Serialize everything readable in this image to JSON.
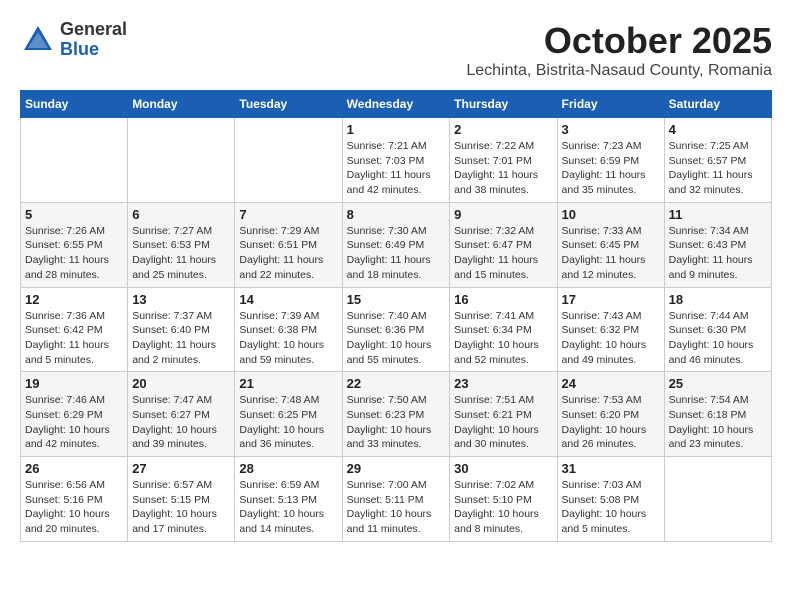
{
  "header": {
    "logo_general": "General",
    "logo_blue": "Blue",
    "month": "October 2025",
    "location": "Lechinta, Bistrita-Nasaud County, Romania"
  },
  "weekdays": [
    "Sunday",
    "Monday",
    "Tuesday",
    "Wednesday",
    "Thursday",
    "Friday",
    "Saturday"
  ],
  "weeks": [
    [
      {
        "day": "",
        "info": ""
      },
      {
        "day": "",
        "info": ""
      },
      {
        "day": "",
        "info": ""
      },
      {
        "day": "1",
        "info": "Sunrise: 7:21 AM\nSunset: 7:03 PM\nDaylight: 11 hours\nand 42 minutes."
      },
      {
        "day": "2",
        "info": "Sunrise: 7:22 AM\nSunset: 7:01 PM\nDaylight: 11 hours\nand 38 minutes."
      },
      {
        "day": "3",
        "info": "Sunrise: 7:23 AM\nSunset: 6:59 PM\nDaylight: 11 hours\nand 35 minutes."
      },
      {
        "day": "4",
        "info": "Sunrise: 7:25 AM\nSunset: 6:57 PM\nDaylight: 11 hours\nand 32 minutes."
      }
    ],
    [
      {
        "day": "5",
        "info": "Sunrise: 7:26 AM\nSunset: 6:55 PM\nDaylight: 11 hours\nand 28 minutes."
      },
      {
        "day": "6",
        "info": "Sunrise: 7:27 AM\nSunset: 6:53 PM\nDaylight: 11 hours\nand 25 minutes."
      },
      {
        "day": "7",
        "info": "Sunrise: 7:29 AM\nSunset: 6:51 PM\nDaylight: 11 hours\nand 22 minutes."
      },
      {
        "day": "8",
        "info": "Sunrise: 7:30 AM\nSunset: 6:49 PM\nDaylight: 11 hours\nand 18 minutes."
      },
      {
        "day": "9",
        "info": "Sunrise: 7:32 AM\nSunset: 6:47 PM\nDaylight: 11 hours\nand 15 minutes."
      },
      {
        "day": "10",
        "info": "Sunrise: 7:33 AM\nSunset: 6:45 PM\nDaylight: 11 hours\nand 12 minutes."
      },
      {
        "day": "11",
        "info": "Sunrise: 7:34 AM\nSunset: 6:43 PM\nDaylight: 11 hours\nand 9 minutes."
      }
    ],
    [
      {
        "day": "12",
        "info": "Sunrise: 7:36 AM\nSunset: 6:42 PM\nDaylight: 11 hours\nand 5 minutes."
      },
      {
        "day": "13",
        "info": "Sunrise: 7:37 AM\nSunset: 6:40 PM\nDaylight: 11 hours\nand 2 minutes."
      },
      {
        "day": "14",
        "info": "Sunrise: 7:39 AM\nSunset: 6:38 PM\nDaylight: 10 hours\nand 59 minutes."
      },
      {
        "day": "15",
        "info": "Sunrise: 7:40 AM\nSunset: 6:36 PM\nDaylight: 10 hours\nand 55 minutes."
      },
      {
        "day": "16",
        "info": "Sunrise: 7:41 AM\nSunset: 6:34 PM\nDaylight: 10 hours\nand 52 minutes."
      },
      {
        "day": "17",
        "info": "Sunrise: 7:43 AM\nSunset: 6:32 PM\nDaylight: 10 hours\nand 49 minutes."
      },
      {
        "day": "18",
        "info": "Sunrise: 7:44 AM\nSunset: 6:30 PM\nDaylight: 10 hours\nand 46 minutes."
      }
    ],
    [
      {
        "day": "19",
        "info": "Sunrise: 7:46 AM\nSunset: 6:29 PM\nDaylight: 10 hours\nand 42 minutes."
      },
      {
        "day": "20",
        "info": "Sunrise: 7:47 AM\nSunset: 6:27 PM\nDaylight: 10 hours\nand 39 minutes."
      },
      {
        "day": "21",
        "info": "Sunrise: 7:48 AM\nSunset: 6:25 PM\nDaylight: 10 hours\nand 36 minutes."
      },
      {
        "day": "22",
        "info": "Sunrise: 7:50 AM\nSunset: 6:23 PM\nDaylight: 10 hours\nand 33 minutes."
      },
      {
        "day": "23",
        "info": "Sunrise: 7:51 AM\nSunset: 6:21 PM\nDaylight: 10 hours\nand 30 minutes."
      },
      {
        "day": "24",
        "info": "Sunrise: 7:53 AM\nSunset: 6:20 PM\nDaylight: 10 hours\nand 26 minutes."
      },
      {
        "day": "25",
        "info": "Sunrise: 7:54 AM\nSunset: 6:18 PM\nDaylight: 10 hours\nand 23 minutes."
      }
    ],
    [
      {
        "day": "26",
        "info": "Sunrise: 6:56 AM\nSunset: 5:16 PM\nDaylight: 10 hours\nand 20 minutes."
      },
      {
        "day": "27",
        "info": "Sunrise: 6:57 AM\nSunset: 5:15 PM\nDaylight: 10 hours\nand 17 minutes."
      },
      {
        "day": "28",
        "info": "Sunrise: 6:59 AM\nSunset: 5:13 PM\nDaylight: 10 hours\nand 14 minutes."
      },
      {
        "day": "29",
        "info": "Sunrise: 7:00 AM\nSunset: 5:11 PM\nDaylight: 10 hours\nand 11 minutes."
      },
      {
        "day": "30",
        "info": "Sunrise: 7:02 AM\nSunset: 5:10 PM\nDaylight: 10 hours\nand 8 minutes."
      },
      {
        "day": "31",
        "info": "Sunrise: 7:03 AM\nSunset: 5:08 PM\nDaylight: 10 hours\nand 5 minutes."
      },
      {
        "day": "",
        "info": ""
      }
    ]
  ]
}
